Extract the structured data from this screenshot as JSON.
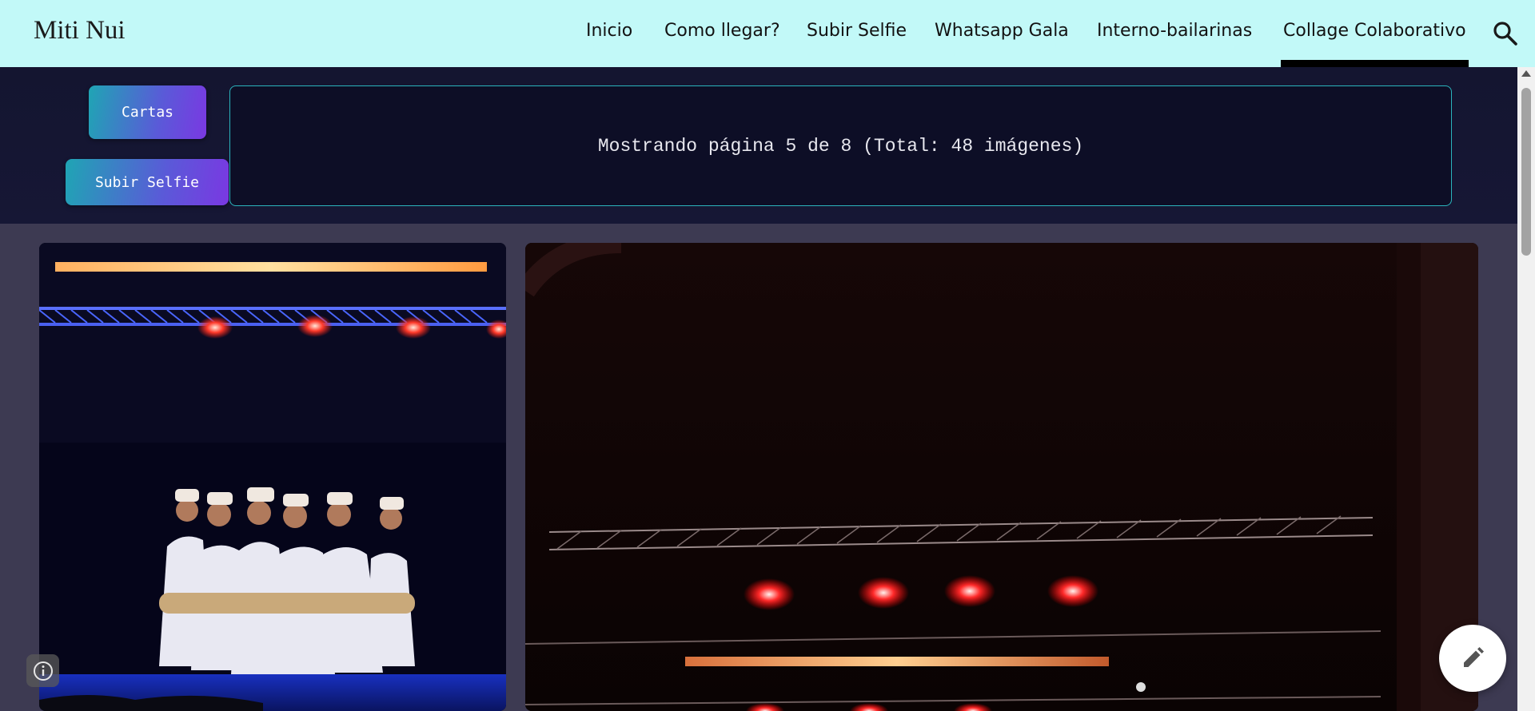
{
  "header": {
    "logo": "Miti Nui",
    "nav": [
      {
        "label": "Inicio"
      },
      {
        "label": "Como llegar?"
      },
      {
        "label": "Subir Selfie"
      },
      {
        "label": "Whatsapp Gala"
      },
      {
        "label": "Interno-bailarinas"
      },
      {
        "label": "Collage Colaborativo",
        "active": true
      }
    ],
    "search_icon": "search-icon"
  },
  "controls": {
    "cartas_label": "Cartas",
    "subir_selfie_label": "Subir Selfie",
    "status": "Mostrando página 5 de 8 (Total: 48 imágenes)"
  },
  "gallery": {
    "photos": [
      {
        "description_icon": "dancers-on-stage-photo"
      },
      {
        "description_icon": "stage-lights-photo"
      }
    ]
  },
  "floating": {
    "info_icon": "info-icon",
    "edit_icon": "pencil-icon"
  },
  "colors": {
    "header_bg": "#c2f9f8",
    "panel_bg": "#141530",
    "accent_teal": "#2bb4bd",
    "accent_purple": "#7a38e2",
    "page_bg": "#3d3a52"
  }
}
